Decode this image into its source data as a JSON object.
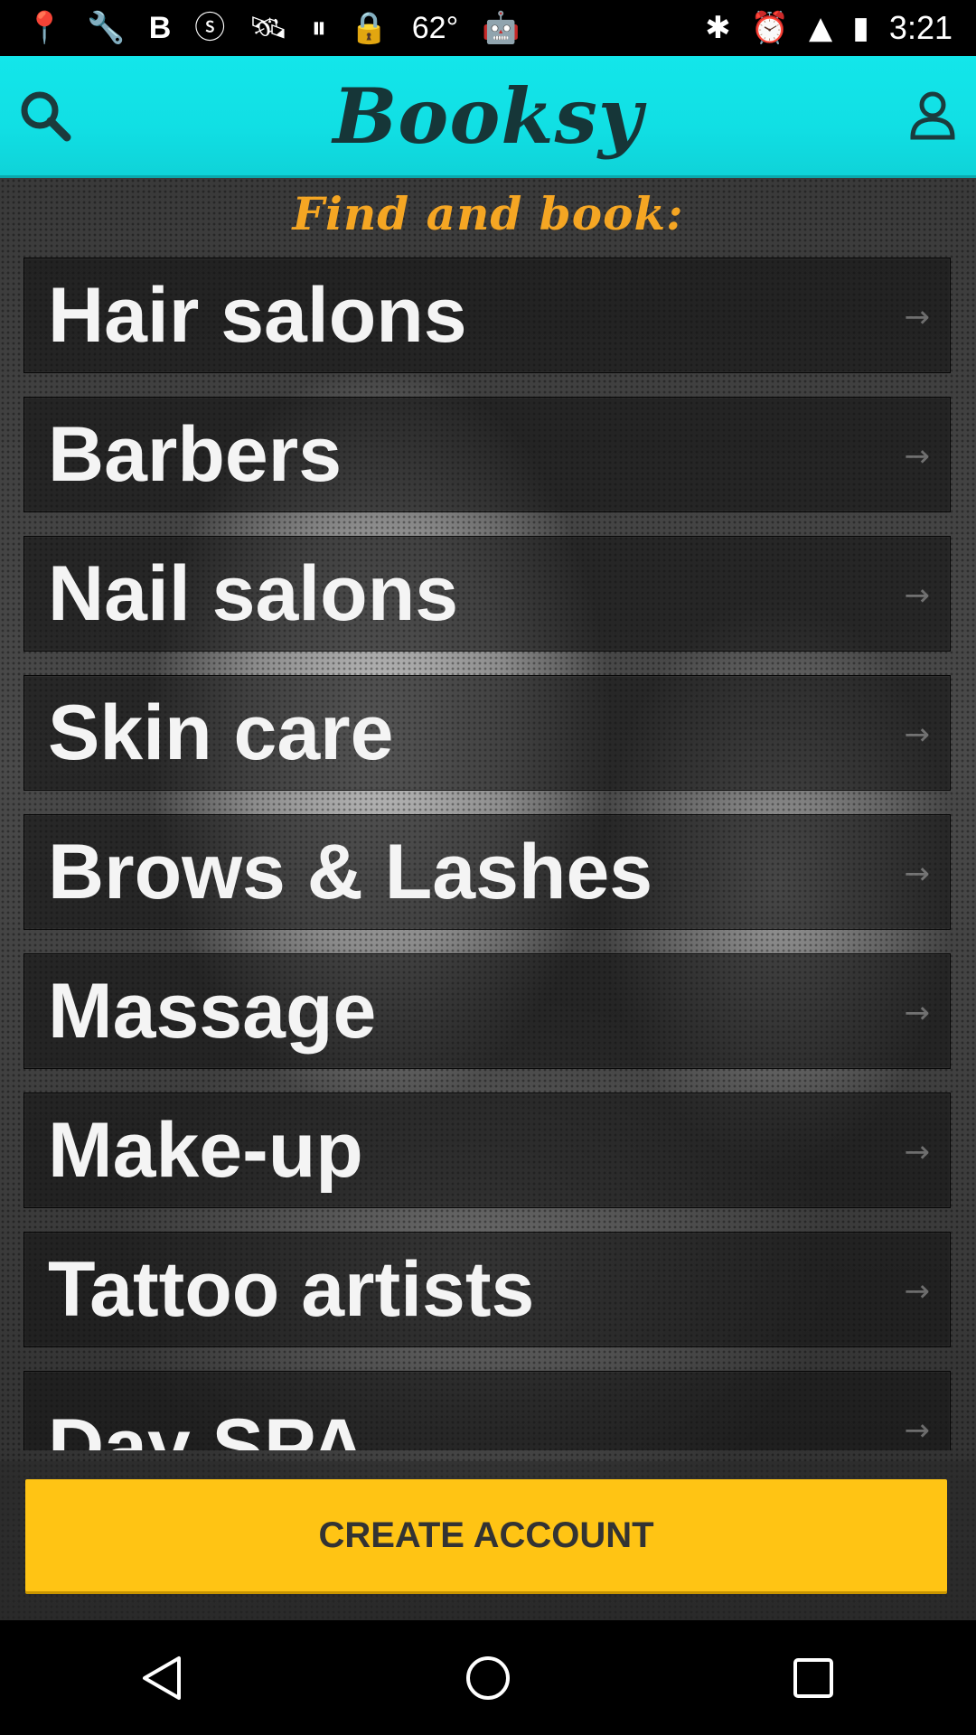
{
  "status_bar": {
    "temperature": "62°",
    "time": "3:21"
  },
  "app_bar": {
    "title": "Booksy",
    "search_icon": "search-icon",
    "profile_icon": "profile-icon",
    "background_color": "#13e6ea"
  },
  "main": {
    "tagline": "Find and book:",
    "tagline_color": "#f5a623",
    "categories": [
      {
        "label": "Hair salons"
      },
      {
        "label": "Barbers"
      },
      {
        "label": "Nail salons"
      },
      {
        "label": "Skin care"
      },
      {
        "label": "Brows & Lashes"
      },
      {
        "label": "Massage"
      },
      {
        "label": "Make-up"
      },
      {
        "label": "Tattoo artists"
      },
      {
        "label": "Day SPA"
      }
    ],
    "arrow_glyph": "→"
  },
  "footer": {
    "create_account_label": "CREATE ACCOUNT",
    "button_color": "#ffc414"
  },
  "nav_bar": {
    "back_icon": "back-icon",
    "home_icon": "home-icon",
    "recents_icon": "recents-icon"
  }
}
